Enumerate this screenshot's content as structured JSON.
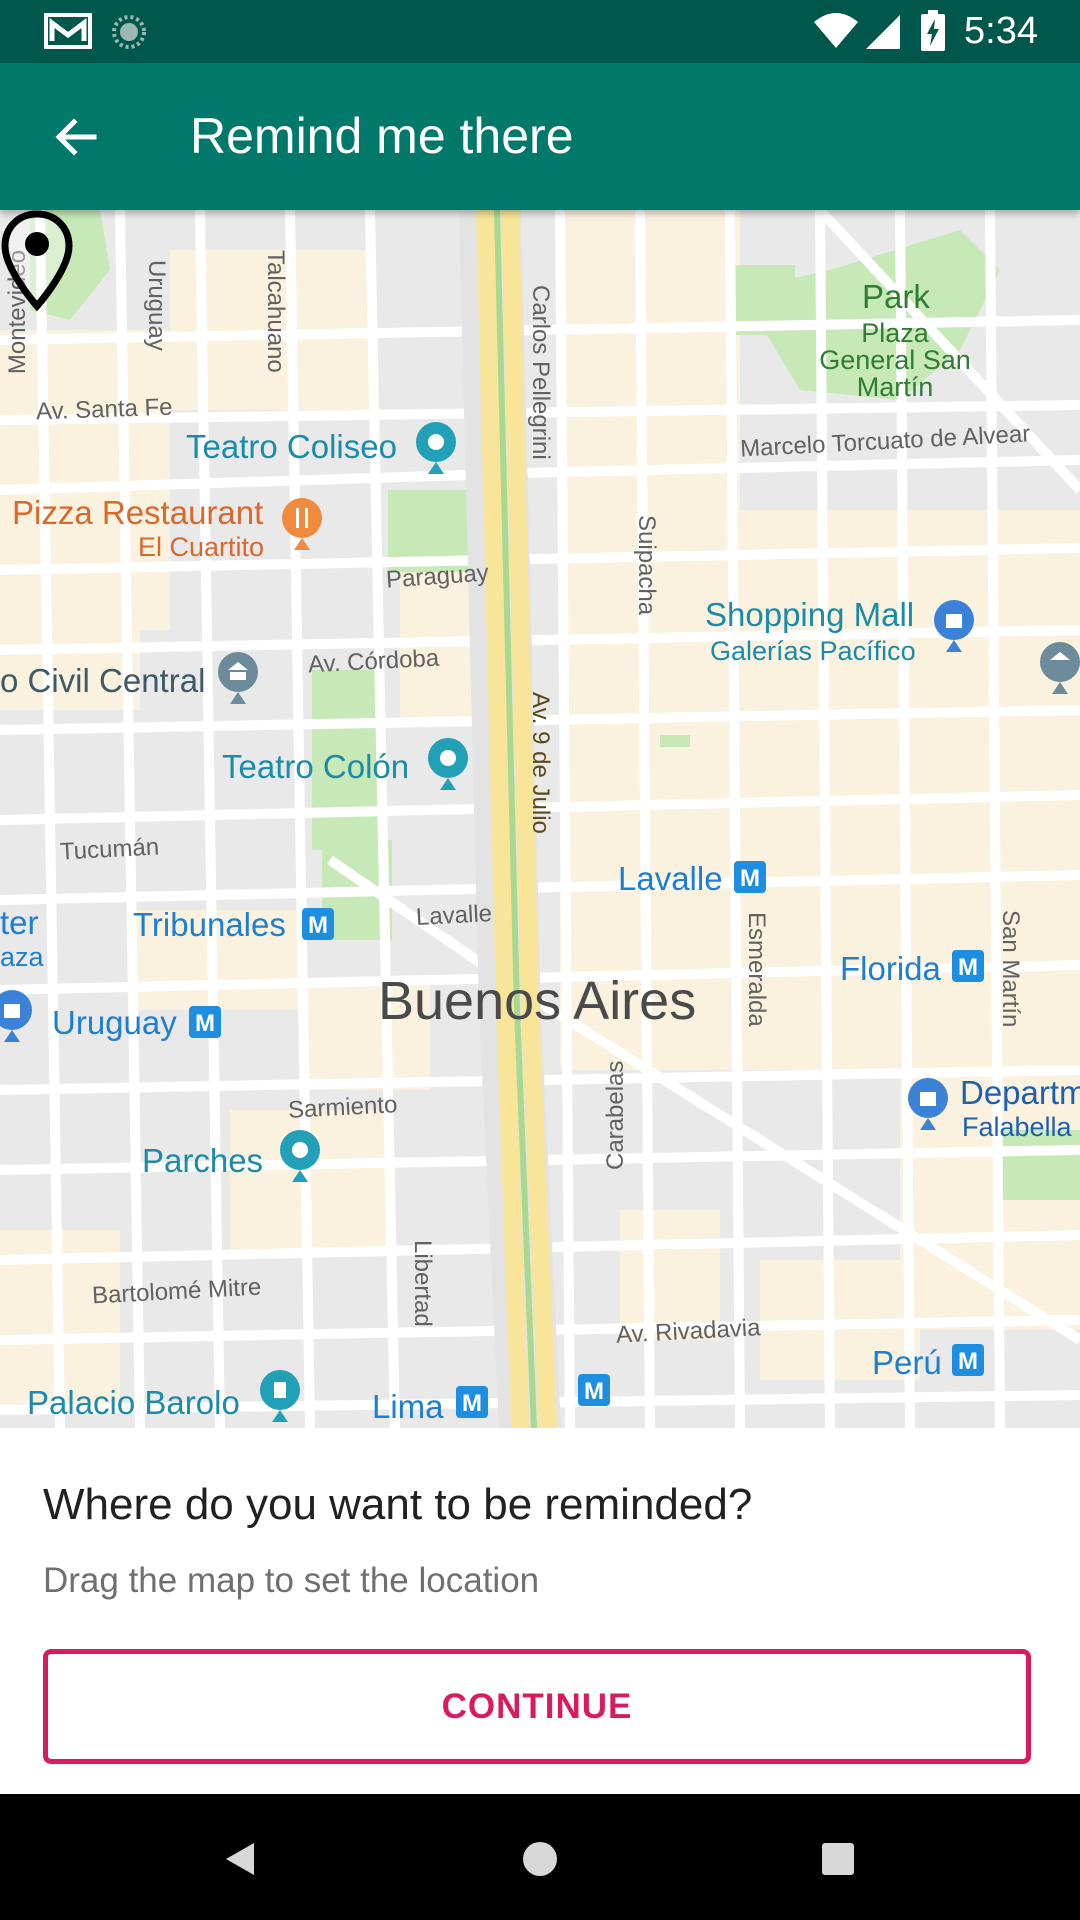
{
  "status_bar": {
    "time": "5:34",
    "icons": [
      "gmail-icon",
      "sync-icon",
      "wifi-icon",
      "signal-icon",
      "battery-charging-icon"
    ]
  },
  "app_bar": {
    "title": "Remind me there",
    "back_icon": "arrow-back-icon"
  },
  "map": {
    "center_label": "Buenos Aires",
    "pin_icon": "location-pin-icon",
    "streets": {
      "montevideo": "Montevideo",
      "uruguay": "Uruguay",
      "talcahuano": "Talcahuano",
      "carlos_pellegrini": "Carlos Pellegrini",
      "av_santa_fe": "Av. Santa Fe",
      "paraguay": "Paraguay",
      "suipacha": "Suipacha",
      "marcelo_alvear": "Marcelo Torcuato de Alvear",
      "av_cordoba": "Av. Córdoba",
      "av_9_de_julio": "Av. 9 de Julio",
      "tucuman": "Tucumán",
      "lavalle": "Lavalle",
      "esmeralda": "Esmeralda",
      "san_martin": "San Martín",
      "sarmiento": "Sarmiento",
      "carabelas": "Carabelas",
      "bartolome_mitre": "Bartolomé Mitre",
      "libertad": "Libertad",
      "av_rivadavia": "Av. Rivadavia"
    },
    "places": {
      "park": "Park",
      "park_sub": "Plaza General San Martín",
      "teatro_coliseo": "Teatro Coliseo",
      "pizza": "Pizza Restaurant",
      "pizza_sub": "El Cuartito",
      "shopping": "Shopping Mall",
      "shopping_sub": "Galerías Pacífico",
      "civil_central": "o Civil Central",
      "teatro_colon": "Teatro Colón",
      "lavalle_metro": "Lavalle",
      "tribunales": "Tribunales",
      "florida": "Florida",
      "left_ter": "ter",
      "left_aza": "aza",
      "uruguay_metro": "Uruguay",
      "department": "Departm",
      "department_sub": "Falabella",
      "parches": "Parches",
      "peru": "Perú",
      "palacio_barolo": "Palacio Barolo",
      "lima": "Lima"
    },
    "metro_badge": "M"
  },
  "panel": {
    "title": "Where do you want to be reminded?",
    "hint": "Drag the map to set the location",
    "continue_label": "CONTINUE"
  },
  "colors": {
    "status_bar": "#00574B",
    "app_bar": "#00796B",
    "accent": "#D81B60",
    "map_bg": "#E9E9E9",
    "block": "#FAF1DE",
    "park": "#C7E8B7",
    "highway": "#F8E59A",
    "poi": "#1A8BA8",
    "metro": "#1E7FD0"
  },
  "navigation": {
    "back_icon": "nav-back-icon",
    "home_icon": "nav-home-icon",
    "recents_icon": "nav-recents-icon"
  }
}
